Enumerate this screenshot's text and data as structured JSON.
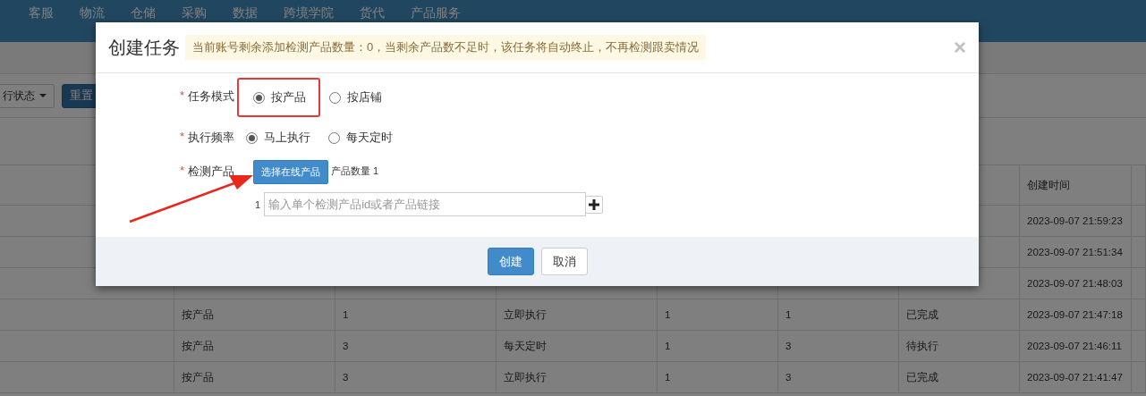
{
  "nav": {
    "items": [
      "客服",
      "物流",
      "仓储",
      "采购",
      "数据",
      "跨境学院",
      "货代",
      "产品服务"
    ]
  },
  "toolbar": {
    "status_filter": "行状态",
    "reset_button": "重置"
  },
  "table": {
    "created_header": "创建时间",
    "rows": [
      {
        "created": "2023-09-07 21:59:23"
      },
      {
        "created": "2023-09-07 21:51:34"
      },
      {
        "created": "2023-09-07 21:48:03"
      },
      {
        "mode": "按产品",
        "column_3": "1",
        "frequency": "立即执行",
        "column_5": "1",
        "column_6": "1",
        "status": "已完成",
        "created": "2023-09-07 21:47:18"
      },
      {
        "mode": "按产品",
        "column_3": "3",
        "frequency": "每天定时",
        "column_5": "1",
        "column_6": "3",
        "status": "待执行",
        "created": "2023-09-07 21:46:11"
      },
      {
        "mode": "按产品",
        "column_3": "3",
        "frequency": "立即执行",
        "column_5": "1",
        "column_6": "3",
        "status": "已完成",
        "created": "2023-09-07 21:41:47"
      }
    ]
  },
  "dialog": {
    "title": "创建任务",
    "notice": "当前账号剩余添加检测产品数量：0，当剩余产品数不足时，该任务将自动终止，不再检测跟卖情况",
    "close": "×",
    "fields": [
      {
        "kind": "radio",
        "marker": "*",
        "label": "任务模式",
        "options": [
          {
            "label": "按产品",
            "selected": true,
            "highlighted": true
          },
          {
            "label": "按店铺",
            "selected": false,
            "highlighted": false
          }
        ]
      },
      {
        "kind": "radio",
        "marker": "*",
        "label": "执行频率",
        "options": [
          {
            "label": "马上执行",
            "selected": true,
            "highlighted": false
          },
          {
            "label": "每天定时",
            "selected": false,
            "highlighted": false
          }
        ]
      },
      {
        "kind": "product",
        "marker": "*",
        "label": "检测产品",
        "button": "选择在线产品",
        "count_text": "产品数量 1",
        "inputs": [
          {
            "index": "1",
            "placeholder": "输入单个检测产品id或者产品链接"
          }
        ]
      }
    ],
    "buttons": [
      {
        "label": "创建",
        "kind": "primary"
      },
      {
        "label": "取消",
        "kind": "default"
      }
    ]
  }
}
